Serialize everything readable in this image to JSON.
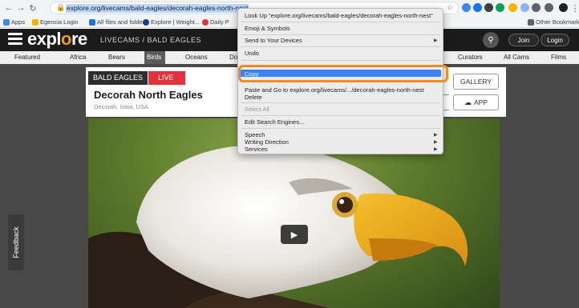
{
  "browser": {
    "url": "explore.org/livecams/bald-eagles/decorah-eagles-north-nest",
    "bookmarks": [
      "Apps",
      "Egencia Login",
      "All files and folder...",
      "Explore | Weight...",
      "Daily P"
    ],
    "other_bookmarks": "Other Bookmarks"
  },
  "site": {
    "logo_prefix": "expl",
    "logo_o": "o",
    "logo_suffix": "re",
    "breadcrumb": "LIVECAMS / BALD EAGLES",
    "join": "Join",
    "login": "Login",
    "categories": [
      "Featured",
      "Africa",
      "Bears",
      "Birds",
      "Oceans",
      "Do",
      "Curators",
      "All Cams",
      "Films"
    ],
    "active_category": "Birds"
  },
  "cam": {
    "tag": "BALD EAGLES",
    "live": "LIVE",
    "title": "Decorah North Eagles",
    "location": "Decorah, Iowa, USA",
    "gallery": "GALLERY",
    "app": "APP"
  },
  "feedback": "Feedback",
  "context_menu": {
    "items": [
      "Look Up “explore.org/livecams/bald-eagles/decorah-eagles-north-nest”",
      "Emoji & Symbols",
      "Send to Your Devices",
      "Undo",
      "Copy",
      "Paste and Go to explore.org/livecams/.../decorah-eagles-north-nest",
      "Delete",
      "Select All",
      "Edit Search Engines...",
      "Speech",
      "Writing Direction",
      "Services"
    ],
    "highlighted": "Copy"
  },
  "colors": {
    "accent_orange": "#f58a1f",
    "highlight_blue": "#3b82f6",
    "live_red": "#e2333b"
  }
}
